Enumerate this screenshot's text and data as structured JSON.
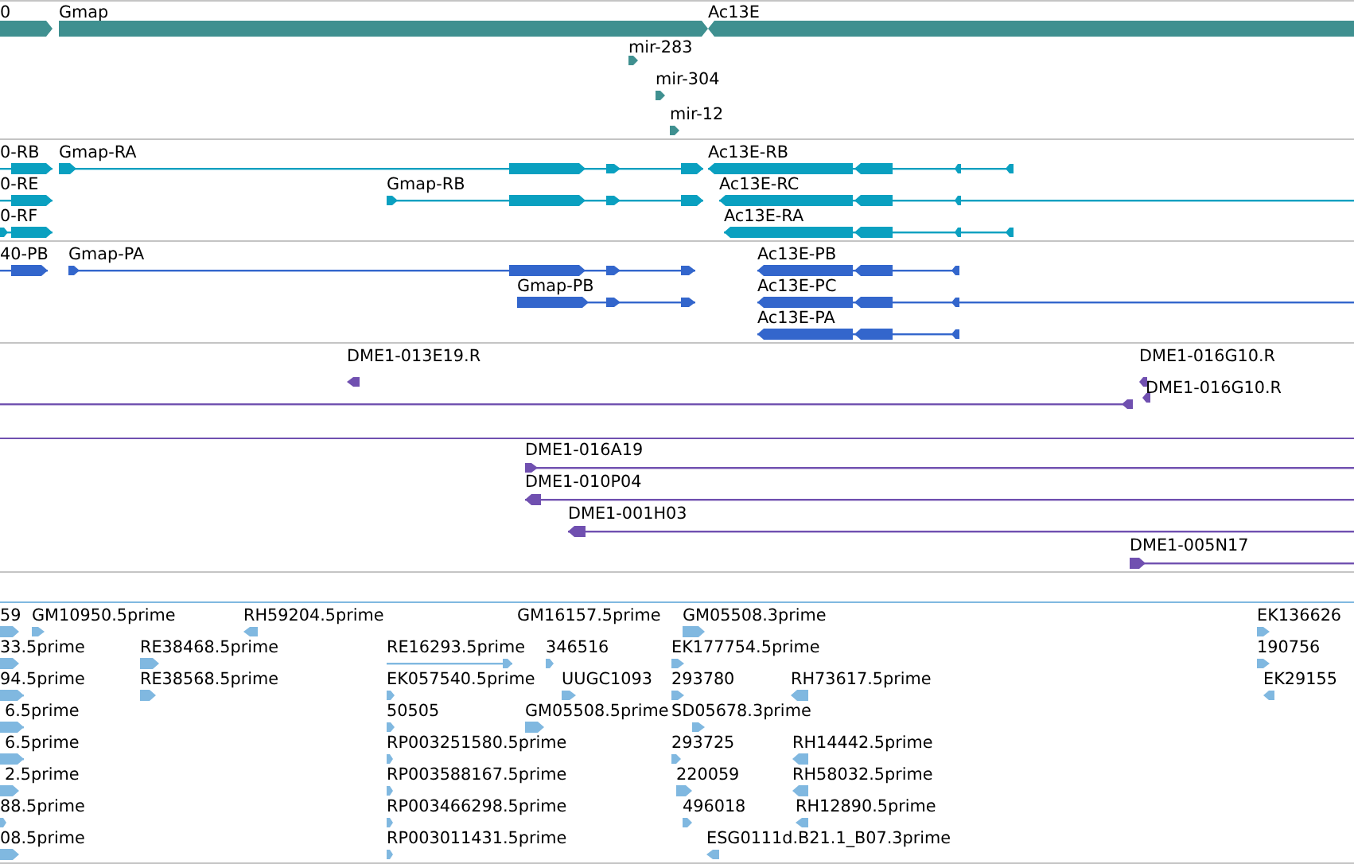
{
  "tracks": [
    {
      "kind": "gene",
      "features": [
        {
          "label": "0",
          "reverse": false
        },
        {
          "label": "Gmap",
          "reverse": false
        },
        {
          "label": "Ac13E",
          "reverse": true
        },
        {
          "label": "mir-283",
          "reverse": false
        },
        {
          "label": "mir-304",
          "reverse": false
        },
        {
          "label": "mir-12",
          "reverse": false
        }
      ]
    },
    {
      "kind": "transcript",
      "features": [
        {
          "label": "0-RB",
          "reverse": false
        },
        {
          "label": "Gmap-RA",
          "reverse": false
        },
        {
          "label": "Ac13E-RB",
          "reverse": true
        },
        {
          "label": "0-RE",
          "reverse": false
        },
        {
          "label": "Gmap-RB",
          "reverse": false
        },
        {
          "label": "Ac13E-RC",
          "reverse": true
        },
        {
          "label": "0-RF",
          "reverse": false
        },
        {
          "label": "Ac13E-RA",
          "reverse": true
        }
      ]
    },
    {
      "kind": "protein",
      "features": [
        {
          "label": "40-PB",
          "reverse": false
        },
        {
          "label": "Gmap-PA",
          "reverse": false
        },
        {
          "label": "Ac13E-PB",
          "reverse": true
        },
        {
          "label": "Gmap-PB",
          "reverse": false
        },
        {
          "label": "Ac13E-PC",
          "reverse": true
        },
        {
          "label": "Ac13E-PA",
          "reverse": true
        }
      ]
    },
    {
      "kind": "clone",
      "features": [
        {
          "label": "DME1-013E19.R",
          "reverse": true
        },
        {
          "label": "DME1-016G10.R",
          "reverse": true
        },
        {
          "label": "DME1-016G10.R",
          "reverse": true
        },
        {
          "reverse": true
        },
        {
          "label": "DME1-016A19",
          "reverse": false
        },
        {
          "label": "DME1-010P04",
          "reverse": true
        },
        {
          "label": "DME1-001H03",
          "reverse": true
        },
        {
          "label": "DME1-005N17",
          "reverse": false
        }
      ]
    },
    {
      "kind": "est",
      "features": [
        {
          "label": "59",
          "reverse": false
        },
        {
          "label": "GM10950.5prime",
          "reverse": false
        },
        {
          "label": "RH59204.5prime",
          "reverse": true
        },
        {
          "label": "GM16157.5prime"
        },
        {
          "label": "GM05508.3prime",
          "reverse": false
        },
        {
          "label": "EK136626",
          "reverse": false
        },
        {
          "label": "33.5prime",
          "reverse": false
        },
        {
          "label": "RE38468.5prime",
          "reverse": false
        },
        {
          "label": "RE16293.5prime",
          "reverse": false
        },
        {
          "label": "346516",
          "reverse": false
        },
        {
          "label": "EK177754.5prime",
          "reverse": false
        },
        {
          "label": "190756",
          "reverse": false
        },
        {
          "label": "94.5prime",
          "reverse": false
        },
        {
          "label": "RE38568.5prime",
          "reverse": false
        },
        {
          "label": "EK057540.5prime",
          "reverse": false
        },
        {
          "label": "UUGC1093",
          "reverse": false
        },
        {
          "label": "293780",
          "reverse": false
        },
        {
          "label": "RH73617.5prime",
          "reverse": true
        },
        {
          "label": "EK29155",
          "reverse": true
        },
        {
          "label": "6.5prime",
          "reverse": false
        },
        {
          "label": "50505",
          "reverse": false
        },
        {
          "label": "GM05508.5prime",
          "reverse": false
        },
        {
          "label": "SD05678.3prime",
          "reverse": false
        },
        {
          "label": "6.5prime",
          "reverse": false
        },
        {
          "label": "RP003251580.5prime",
          "reverse": false
        },
        {
          "label": "293725",
          "reverse": false
        },
        {
          "label": "RH14442.5prime",
          "reverse": true
        },
        {
          "label": "2.5prime",
          "reverse": false
        },
        {
          "label": "RP003588167.5prime",
          "reverse": false
        },
        {
          "label": "220059",
          "reverse": false
        },
        {
          "label": "RH58032.5prime",
          "reverse": true
        },
        {
          "label": "88.5prime",
          "reverse": false
        },
        {
          "label": "RP003466298.5prime",
          "reverse": false
        },
        {
          "label": "496018",
          "reverse": false
        },
        {
          "label": "RH12890.5prime",
          "reverse": true
        },
        {
          "label": "08.5prime",
          "reverse": false
        },
        {
          "label": "RP003011431.5prime",
          "reverse": false
        },
        {
          "label": "ESG0111d.B21.1_B07.3prime",
          "reverse": true
        }
      ]
    }
  ]
}
